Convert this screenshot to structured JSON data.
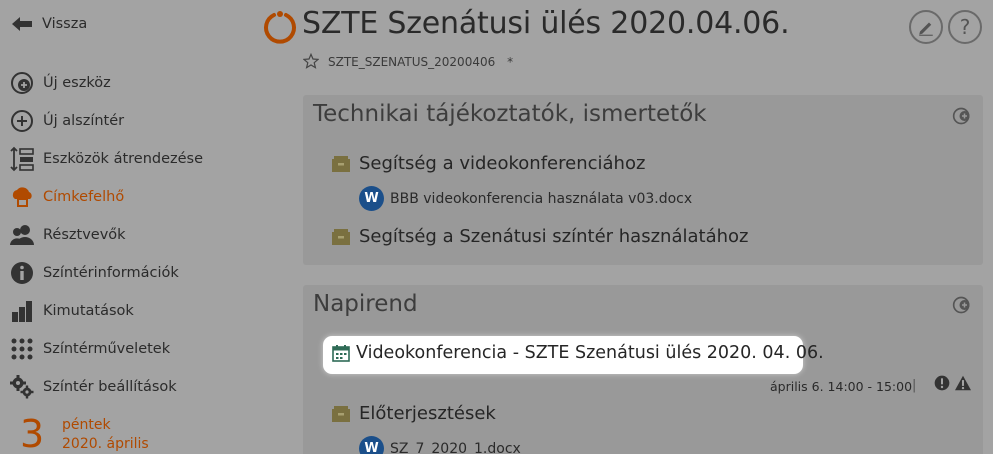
{
  "nav": {
    "back_label": "Vissza"
  },
  "header": {
    "title": "SZTE Szenátusi ülés 2020.04.06.",
    "code": "SZTE_SZENATUS_20200406",
    "asterisk": "*"
  },
  "sidebar": {
    "items": [
      {
        "label": "Új eszköz",
        "icon": "plus-circle-icon"
      },
      {
        "label": "Új alszíntér",
        "icon": "plus-circle-outline-icon"
      },
      {
        "label": "Eszközök átrendezése",
        "icon": "reorder-icon"
      },
      {
        "label": "Címkefelhő",
        "icon": "tag-cloud-icon",
        "active": true
      },
      {
        "label": "Résztvevők",
        "icon": "users-icon"
      },
      {
        "label": "Színtérinformációk",
        "icon": "info-icon"
      },
      {
        "label": "Kimutatások",
        "icon": "bar-chart-icon"
      },
      {
        "label": "Színtérműveletek",
        "icon": "grid-dots-icon"
      },
      {
        "label": "Színtér beállítások",
        "icon": "gears-icon"
      }
    ]
  },
  "date": {
    "day": "3",
    "weekday": "péntek",
    "month": "2020. április"
  },
  "sections": {
    "tech": {
      "title": "Technikai tájékoztatók, ismertetők",
      "folder1": "Segítség a videokonferenciához",
      "file1": "BBB videokonferencia használata v03.docx",
      "folder2": "Segítség a Szenátusi színtér használatához"
    },
    "agenda": {
      "title": "Napirend",
      "event": "Videokonferencia - SZTE Szenátusi ülés 2020. 04. 06.",
      "event_time": "április 6. 14:00 - 15:00",
      "separator": "|",
      "folder": "Előterjesztések",
      "file": "SZ_7_2020_1.docx"
    }
  },
  "word_badge": "W",
  "colors": {
    "accent": "#b04a00",
    "word_blue": "#1b4f8a",
    "folder": "#7a7040"
  }
}
